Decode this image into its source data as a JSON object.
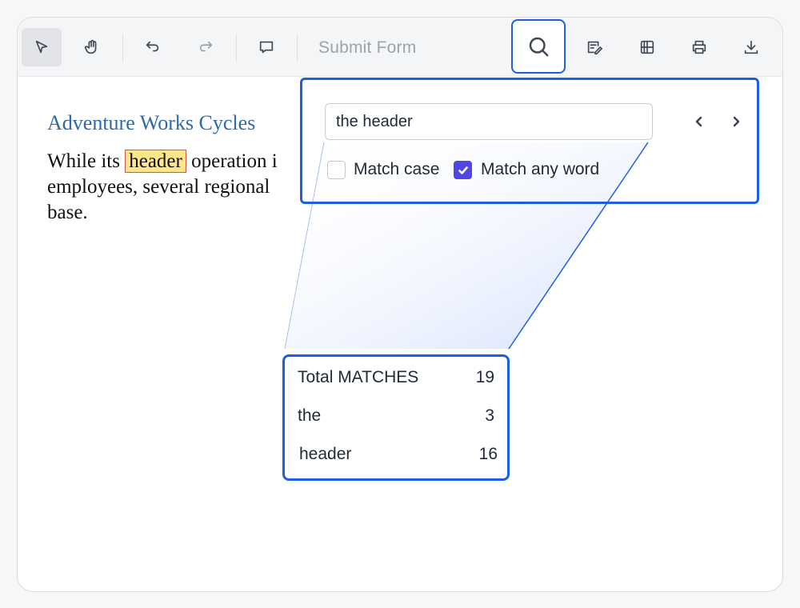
{
  "toolbar": {
    "tools": [
      {
        "name": "select-tool",
        "icon": "cursor-arrow-icon",
        "active": true
      },
      {
        "name": "pan-tool",
        "icon": "hand-icon"
      },
      {
        "name": "undo",
        "icon": "undo-icon"
      },
      {
        "name": "redo",
        "icon": "redo-icon",
        "disabled": true
      },
      {
        "name": "comment",
        "icon": "comment-bubble-icon"
      },
      {
        "name": "form-designer",
        "icon": "form-edit-icon"
      },
      {
        "name": "organize-pages",
        "icon": "grid-pages-icon"
      },
      {
        "name": "print",
        "icon": "printer-icon"
      },
      {
        "name": "download",
        "icon": "download-icon"
      }
    ],
    "submit_form_label": "Submit Form",
    "search_icon": "search-icon"
  },
  "document": {
    "title": "Adventure Works Cycles",
    "lines": [
      {
        "before": " While its ",
        "highlight": "header",
        "after": " operation i"
      },
      {
        "text": "employees, several regional"
      },
      {
        "text": "base."
      }
    ]
  },
  "find": {
    "query": "the header",
    "prev_icon": "chevron-left-icon",
    "next_icon": "chevron-right-icon",
    "match_case": {
      "label": "Match case",
      "checked": false
    },
    "match_any_word": {
      "label": "Match any word",
      "checked": true
    }
  },
  "results": {
    "rows": [
      {
        "label": "Total MATCHES",
        "count": "19"
      },
      {
        "label": "the",
        "count": "3"
      },
      {
        "label": "header",
        "count": "16"
      }
    ]
  },
  "colors": {
    "accent": "#1d5fe0",
    "checkbox": "#4f46e5",
    "highlight": "#fde58a",
    "title": "#2f6aa8"
  }
}
